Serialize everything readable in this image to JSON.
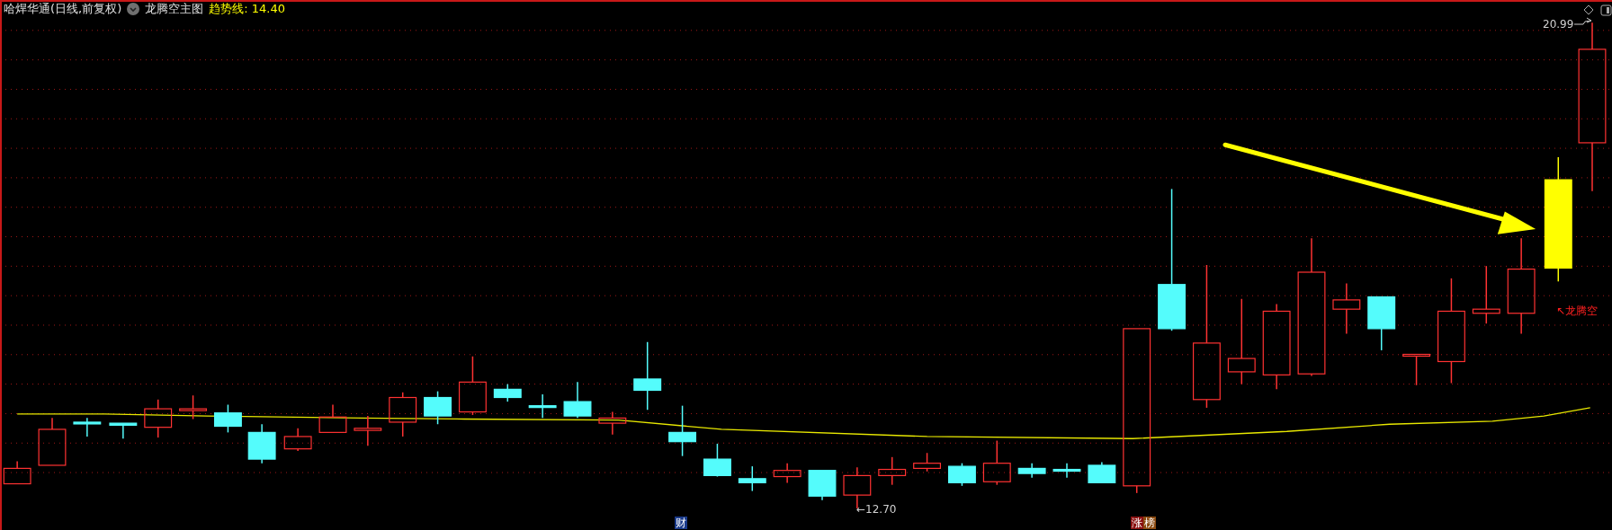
{
  "header": {
    "symbol": "哈焊华通(日线,前复权)",
    "indicator": "龙腾空主图",
    "trend_label": "趋势线:",
    "trend_value": "14.40"
  },
  "chart_labels": {
    "high_price": "20.99",
    "low_price": "←12.70",
    "signal": "↖龙腾空"
  },
  "markers": [
    {
      "text": "财",
      "kind": "finance"
    },
    {
      "text": "涨",
      "kind": "limit_up"
    },
    {
      "text": "榜",
      "kind": "ranking"
    }
  ]
}
